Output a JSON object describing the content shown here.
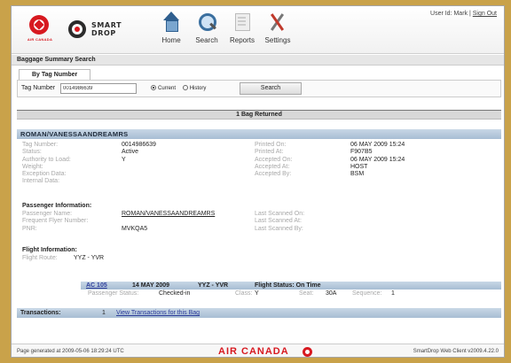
{
  "header": {
    "brand": {
      "airline_logo_text": "AIR CANADA",
      "app_logo_line1": "SMART",
      "app_logo_line2": "DROP"
    },
    "nav": [
      {
        "label": "Home",
        "icon": "home-icon"
      },
      {
        "label": "Search",
        "icon": "search-icon"
      },
      {
        "label": "Reports",
        "icon": "reports-icon"
      },
      {
        "label": "Settings",
        "icon": "settings-icon"
      }
    ],
    "user": {
      "user_id_text": "User Id: Mark |",
      "sign_out": "Sign Out"
    }
  },
  "page": {
    "section_title": "Baggage Summary Search",
    "tab_label": "By Tag Number",
    "search": {
      "tag_label": "Tag Number",
      "tag_value": "0014986639",
      "radio_current": "Current",
      "radio_history": "History",
      "button": "Search"
    },
    "result_text": "1 Bag Returned"
  },
  "bag": {
    "name_header": "ROMAN/VANESSAANDREAMRS",
    "left": [
      {
        "label": "Tag Number:",
        "value": "0014986639"
      },
      {
        "label": "Status:",
        "value": "Active"
      },
      {
        "label": "Authority to Load:",
        "value": "Y"
      },
      {
        "label": "Weight:",
        "value": ""
      },
      {
        "label": "Exception Data:",
        "value": ""
      },
      {
        "label": "Internal Data:",
        "value": ""
      }
    ],
    "right": [
      {
        "label": "Printed On:",
        "value": "06 MAY 2009 15:24"
      },
      {
        "label": "Printed At:",
        "value": "F907B5"
      },
      {
        "label": "Accepted On:",
        "value": "06 MAY 2009 15:24"
      },
      {
        "label": "Accepted At:",
        "value": "HOST"
      },
      {
        "label": "Accepted By:",
        "value": "BSM"
      }
    ],
    "passenger_heading": "Passenger Information:",
    "passenger_left": [
      {
        "label": "Passenger Name:",
        "value": "ROMAN/VANESSAANDREAMRS"
      },
      {
        "label": "Frequent Flyer Number:",
        "value": ""
      },
      {
        "label": "PNR:",
        "value": "MVKQA5"
      }
    ],
    "passenger_right": [
      {
        "label": "Last Scanned On:",
        "value": ""
      },
      {
        "label": "Last Scanned At:",
        "value": ""
      },
      {
        "label": "Last Scanned By:",
        "value": ""
      }
    ],
    "flight_heading": "Flight Information:",
    "flight_route_label": "Flight Route:",
    "flight_route_value": "YYZ - YVR",
    "flight": {
      "number": "AC 105",
      "date": "14 MAY 2009",
      "route": "YYZ - YVR",
      "status": "Flight Status: On Time",
      "passenger_status_label": "Passenger Status:",
      "passenger_status": "Checked-in",
      "class_label": "Class:",
      "class_value": "Y",
      "seat_label": "Seat:",
      "seat_value": "30A",
      "sequence_label": "Sequence:",
      "sequence_value": "1"
    },
    "transactions": {
      "label": "Transactions:",
      "count": "1",
      "link": "View Transactions for this Bag"
    }
  },
  "footer": {
    "generated": "Page generated at 2009-05-06 18:29:24 UTC",
    "brand": "AIR CANADA",
    "version": "SmartDrop Web Client v2009.4.22.0"
  },
  "colors": {
    "brand_red": "#d71920",
    "band_blue": "#b3c7db"
  }
}
